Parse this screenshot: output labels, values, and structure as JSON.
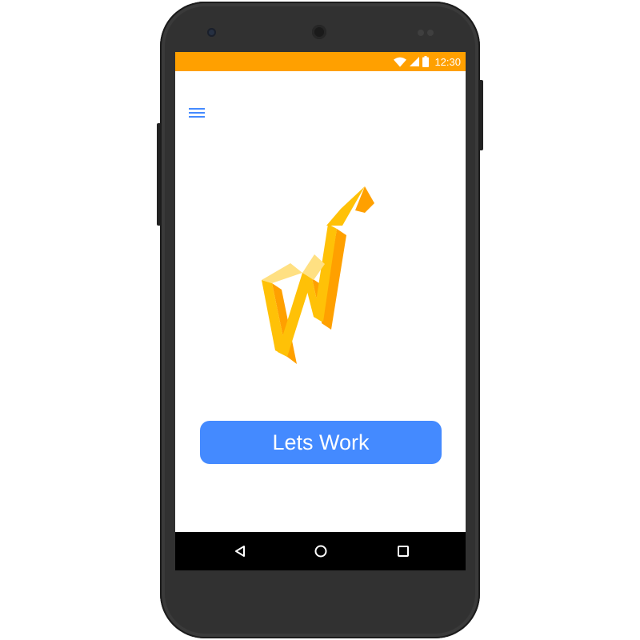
{
  "status_bar": {
    "time": "12:30",
    "background_color": "#FFA000",
    "icons": [
      "wifi-icon",
      "signal-icon",
      "battery-icon"
    ]
  },
  "app_bar": {
    "menu_icon": "hamburger-menu-icon",
    "icon_color": "#448AFF"
  },
  "main": {
    "logo_icon": "rising-arrow-logo",
    "logo_colors": [
      "#FFC107",
      "#FFA000",
      "#FFE082"
    ],
    "cta_label": "Lets Work",
    "cta_color": "#448AFF"
  },
  "navigation_bar": {
    "buttons": [
      "back-icon",
      "home-icon",
      "recents-icon"
    ]
  }
}
